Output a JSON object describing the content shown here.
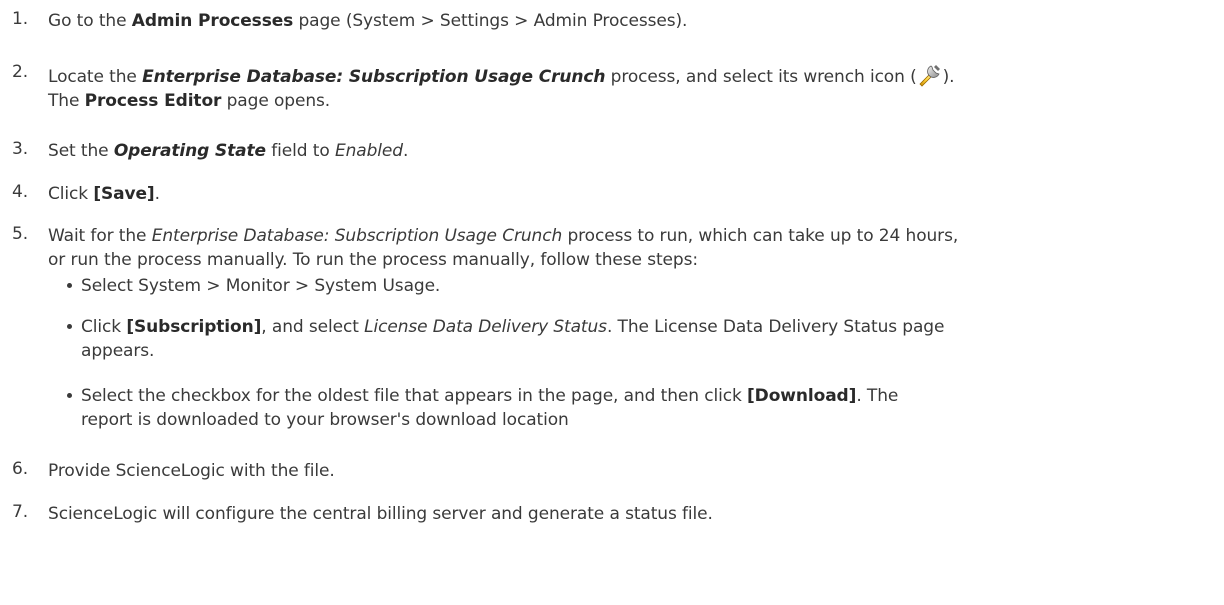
{
  "steps": [
    {
      "number": "1.",
      "parts": {
        "a": "Go to the ",
        "b": "Admin Processes",
        "c": " page (System > Settings > Admin Processes)."
      }
    },
    {
      "number": "2.",
      "parts": {
        "a": "Locate the ",
        "b": "Enterprise Database: Subscription Usage Crunch",
        "c": " process, and select its wrench icon (",
        "d": ").",
        "e": "The ",
        "f": "Process Editor",
        "g": " page opens."
      },
      "icon": "wrench-icon"
    },
    {
      "number": "3.",
      "parts": {
        "a": "Set the ",
        "b": "Operating State",
        "c": " field to ",
        "d": "Enabled",
        "e": "."
      }
    },
    {
      "number": "4.",
      "parts": {
        "a": "Click ",
        "b": "[Save]",
        "c": "."
      }
    },
    {
      "number": "5.",
      "parts": {
        "a": "Wait for the ",
        "b": "Enterprise Database: Subscription Usage Crunch",
        "c": " process to run, which can take up to 24 hours,",
        "d": "or run the process manually. To run the process manually, follow these steps:"
      },
      "substeps": [
        {
          "a": "Select System > Monitor > System Usage."
        },
        {
          "a": "Click ",
          "b": "[Subscription]",
          "c": ", and select ",
          "d": "License Data Delivery Status",
          "e": ". The License Data Delivery Status page",
          "f": "appears."
        },
        {
          "a": "Select the checkbox for the oldest file that appears in the page, and then click ",
          "b": "[Download]",
          "c": ". The",
          "d": "report is downloaded to your browser's download location"
        }
      ]
    },
    {
      "number": "6.",
      "parts": {
        "a": "Provide ScienceLogic with the file."
      }
    },
    {
      "number": "7.",
      "parts": {
        "a": "ScienceLogic will configure the central billing server and generate a status file."
      }
    }
  ]
}
